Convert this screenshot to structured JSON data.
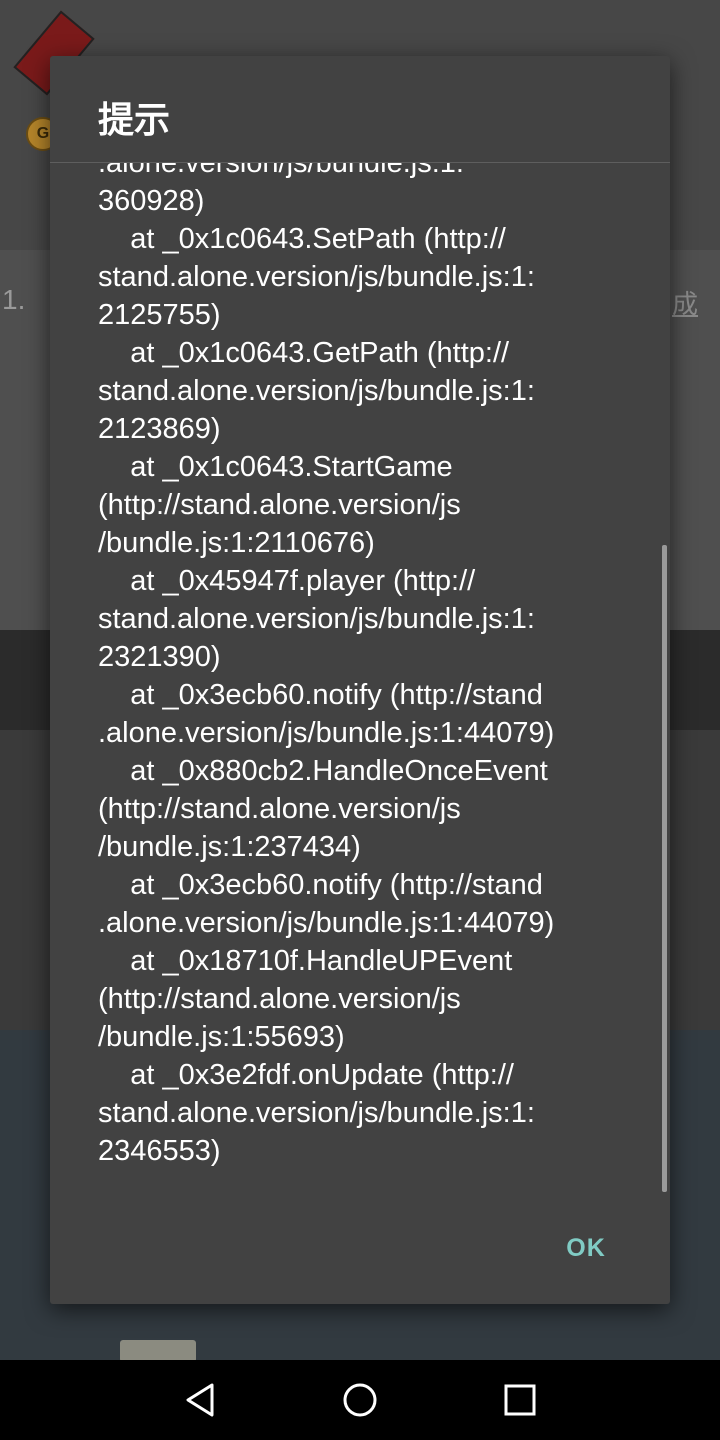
{
  "dialog": {
    "title": "提示",
    "message": ".alone.version/js/bundle.js:1:\n360928)\n    at _0x1c0643.SetPath (http://\nstand.alone.version/js/bundle.js:1:\n2125755)\n    at _0x1c0643.GetPath (http://\nstand.alone.version/js/bundle.js:1:\n2123869)\n    at _0x1c0643.StartGame\n(http://stand.alone.version/js\n/bundle.js:1:2110676)\n    at _0x45947f.player (http://\nstand.alone.version/js/bundle.js:1:\n2321390)\n    at _0x3ecb60.notify (http://stand\n.alone.version/js/bundle.js:1:44079)\n    at _0x880cb2.HandleOnceEvent\n(http://stand.alone.version/js\n/bundle.js:1:237434)\n    at _0x3ecb60.notify (http://stand\n.alone.version/js/bundle.js:1:44079)\n    at _0x18710f.HandleUPEvent\n(http://stand.alone.version/js\n/bundle.js:1:55693)\n    at _0x3e2fdf.onUpdate (http://\nstand.alone.version/js/bundle.js:1:\n2346553)",
    "ok_label": "OK",
    "accent_color": "#80cbc4"
  },
  "background": {
    "line_number": "1.",
    "coin_icon": "coin-icon",
    "right_text": "成"
  },
  "navbar": {
    "back_icon": "back-triangle-icon",
    "home_icon": "home-circle-icon",
    "recents_icon": "recents-square-icon"
  }
}
